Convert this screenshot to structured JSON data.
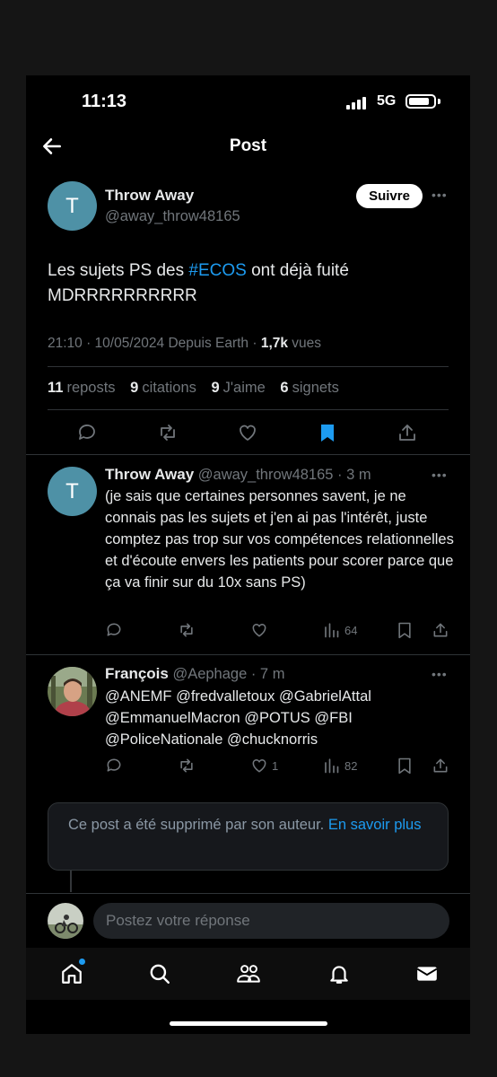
{
  "status": {
    "time": "11:13",
    "network": "5G"
  },
  "header": {
    "title": "Post"
  },
  "main_post": {
    "avatar_letter": "T",
    "name": "Throw Away",
    "handle": "@away_throw48165",
    "follow_label": "Suivre",
    "text_prefix": "Les sujets PS des ",
    "hashtag": "#ECOS",
    "text_suffix": " ont déjà fuité MDRRRRRRRRRR",
    "timestamp": "21:10 · 10/05/2024 Depuis Earth · ",
    "views_count": "1,7k",
    "views_label": " vues",
    "stats": {
      "reposts_count": "11",
      "reposts_label": "reposts",
      "quotes_count": "9",
      "quotes_label": "citations",
      "likes_count": "9",
      "likes_label": "J'aime",
      "bookmarks_count": "6",
      "bookmarks_label": "signets"
    }
  },
  "replies": [
    {
      "avatar_letter": "T",
      "name": "Throw Away",
      "handle_time": "@away_throw48165 · 3 m",
      "text": "(je sais que certaines personnes savent, je ne connais pas les sujets et j'en ai pas l'intérêt, juste comptez pas trop sur vos compétences relationnelles et d'écoute envers les patients pour scorer parce que ça va finir sur du 10x sans PS)",
      "views": "64"
    },
    {
      "name": "François",
      "handle_time": "@Aephage · 7 m",
      "mentions": "@ANEMF @fredvalletoux @GabrielAttal @EmmanuelMacron @POTUS @FBI @PoliceNationale @chucknorris",
      "likes": "1",
      "views": "82"
    }
  ],
  "deleted_notice": {
    "text": "Ce post a été supprimé par son auteur. ",
    "link": "En savoir plus"
  },
  "composer": {
    "placeholder": "Postez votre réponse"
  },
  "colors": {
    "accent": "#1d9bf0",
    "background": "#000000",
    "avatar_teal": "#4e91a6"
  },
  "tabs": [
    "home-icon",
    "search-icon",
    "communities-icon",
    "notifications-icon",
    "messages-icon"
  ]
}
